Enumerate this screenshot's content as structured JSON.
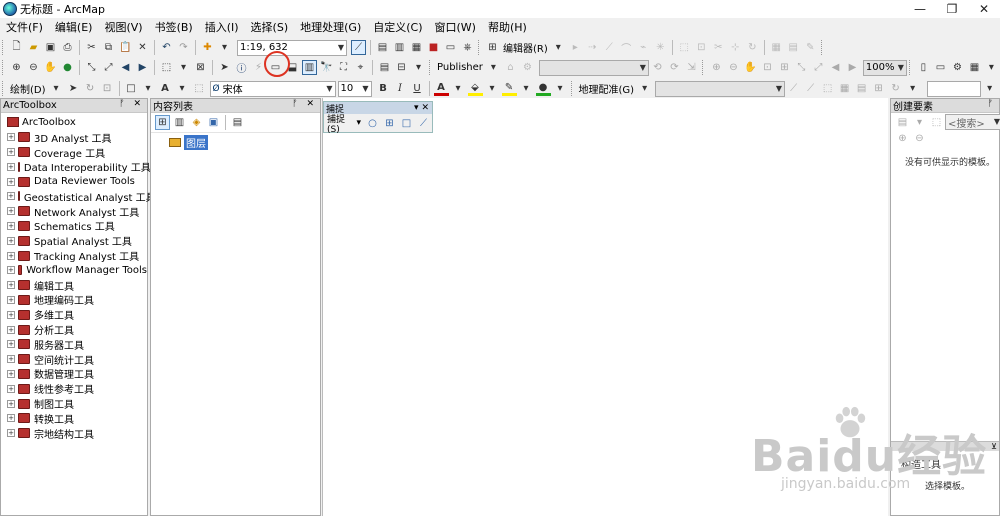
{
  "window": {
    "title": "无标题 - ArcMap"
  },
  "menu": [
    "文件(F)",
    "编辑(E)",
    "视图(V)",
    "书签(B)",
    "插入(I)",
    "选择(S)",
    "地理处理(G)",
    "自定义(C)",
    "窗口(W)",
    "帮助(H)"
  ],
  "toolbar": {
    "scale_value": "1:19, 632",
    "editor_label": "编辑器(R)",
    "publisher_label": "Publisher",
    "zoom_percent": "100%",
    "draw_label": "绘制(D)",
    "font_name": "宋体",
    "font_size": "10",
    "bold": "B",
    "italic": "I",
    "underline": "U",
    "georef_label": "地理配准(G)"
  },
  "arctoolbox": {
    "title": "ArcToolbox",
    "root": "ArcToolbox",
    "items": [
      "3D Analyst 工具",
      "Coverage 工具",
      "Data Interoperability 工具",
      "Data Reviewer Tools",
      "Geostatistical Analyst 工具",
      "Network Analyst 工具",
      "Schematics 工具",
      "Spatial Analyst 工具",
      "Tracking Analyst 工具",
      "Workflow Manager Tools",
      "编辑工具",
      "地理编码工具",
      "多维工具",
      "分析工具",
      "服务器工具",
      "空间统计工具",
      "数据管理工具",
      "线性参考工具",
      "制图工具",
      "转换工具",
      "宗地结构工具"
    ]
  },
  "toc": {
    "title": "内容列表",
    "layer": "图层"
  },
  "snapping": {
    "title": "捕捉",
    "menu_label": "捕捉(S)"
  },
  "create_features": {
    "title": "创建要素",
    "search_placeholder": "<搜索>",
    "empty_text": "没有可供显示的模板。",
    "lower_label": "构造工具",
    "lower_text": "选择模板。"
  },
  "watermark": {
    "main": "Baidu经验",
    "sub": "jingyan.baidu.com"
  },
  "colors": {
    "highlight_ring": "#dd3322",
    "font_color_red": "#cc0000",
    "highlight_yellow": "#ffee00",
    "line_green": "#22aa22"
  }
}
